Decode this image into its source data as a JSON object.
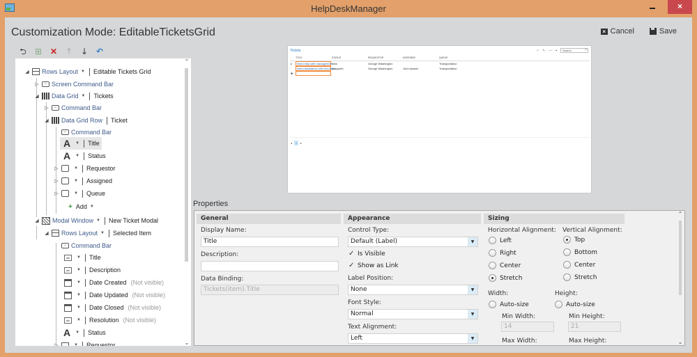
{
  "window": {
    "title": "HelpDeskManager",
    "close_glyph": "×"
  },
  "header": {
    "page_title": "Customization Mode: EditableTicketsGrid",
    "cancel_label": "Cancel",
    "save_label": "Save"
  },
  "tree_toolbar": {
    "add_glyph": "⮌",
    "add_row_glyph": "⊞",
    "delete_glyph": "✕",
    "up_glyph": "↑",
    "down_glyph": "↓",
    "undo_glyph": "↶"
  },
  "tree": {
    "nodes": [
      {
        "type": "Rows Layout",
        "name": "Editable Tickets Grid"
      },
      {
        "type": "Screen Command Bar"
      },
      {
        "type": "Data Grid",
        "name": "Tickets"
      },
      {
        "type": "Command Bar"
      },
      {
        "type": "Data Grid Row",
        "name": "Ticket"
      },
      {
        "type": "Command Bar"
      },
      {
        "name": "Title"
      },
      {
        "name": "Status"
      },
      {
        "name": "Requestor"
      },
      {
        "name": "Assigned"
      },
      {
        "name": "Queue"
      },
      {
        "label": "Add"
      },
      {
        "type": "Modal Window",
        "name": "New Ticket Modal"
      },
      {
        "type": "Rows Layout",
        "name": "Selected Item"
      },
      {
        "type": "Command Bar"
      },
      {
        "name": "Title"
      },
      {
        "name": "Description"
      },
      {
        "name": "Date Created",
        "note": "(Not visible)"
      },
      {
        "name": "Date Updated",
        "note": "(Not visible)"
      },
      {
        "name": "Date Closed",
        "note": "(Not visible)"
      },
      {
        "name": "Resolution",
        "note": "(Not visible)"
      },
      {
        "name": "Status"
      },
      {
        "name": "Requestor"
      }
    ]
  },
  "preview": {
    "title": "Tickets",
    "search_placeholder": "Search",
    "columns": [
      "Title",
      "Status",
      "Requestor",
      "Assigned",
      "Queue"
    ],
    "rows": [
      {
        "title": "Need help with management",
        "status": "New",
        "requestor": "George Washington",
        "assigned": "",
        "queue": "Transportation"
      },
      {
        "title": "Need assistance with mountain",
        "status": "Assigned",
        "requestor": "George Washington",
        "assigned": "John Adams",
        "queue": "Transportation"
      }
    ],
    "pager": {
      "prev": "◂",
      "current": "1",
      "next": "▸"
    }
  },
  "properties": {
    "label": "Properties",
    "general": {
      "header": "General",
      "display_name_label": "Display Name:",
      "display_name_value": "Title",
      "description_label": "Description:",
      "description_value": "",
      "data_binding_label": "Data Binding:",
      "data_binding_value": "Tickets(item).Title"
    },
    "appearance": {
      "header": "Appearance",
      "control_type_label": "Control Type:",
      "control_type_value": "Default (Label)",
      "is_visible_label": "Is Visible",
      "is_visible": true,
      "show_as_link_label": "Show as Link",
      "show_as_link": true,
      "label_position_label": "Label Position:",
      "label_position_value": "None",
      "font_style_label": "Font Style:",
      "font_style_value": "Normal",
      "text_alignment_label": "Text Alignment:",
      "text_alignment_value": "Left"
    },
    "sizing": {
      "header": "Sizing",
      "horizontal_label": "Horizontal Alignment:",
      "horizontal_options": [
        "Left",
        "Right",
        "Center",
        "Stretch"
      ],
      "horizontal_selected": "Stretch",
      "vertical_label": "Vertical Alignment:",
      "vertical_options": [
        "Top",
        "Bottom",
        "Center",
        "Stretch"
      ],
      "vertical_selected": "Top",
      "width_label": "Width:",
      "width_option": "Auto-size",
      "height_label": "Height:",
      "height_option": "Auto-size",
      "min_width_label": "Min Width:",
      "min_width_value": "14",
      "min_height_label": "Min Height:",
      "min_height_value": "21",
      "max_width_label": "Max Width:",
      "max_height_label": "Max Height:"
    }
  },
  "colors": {
    "frame": "#e3a06a",
    "client_bg": "#d6d7d8",
    "close_button": "#c9484d",
    "link_blue": "#2a7ac0",
    "selection_orange": "#f08a3a",
    "delete_red": "#c8221d"
  }
}
